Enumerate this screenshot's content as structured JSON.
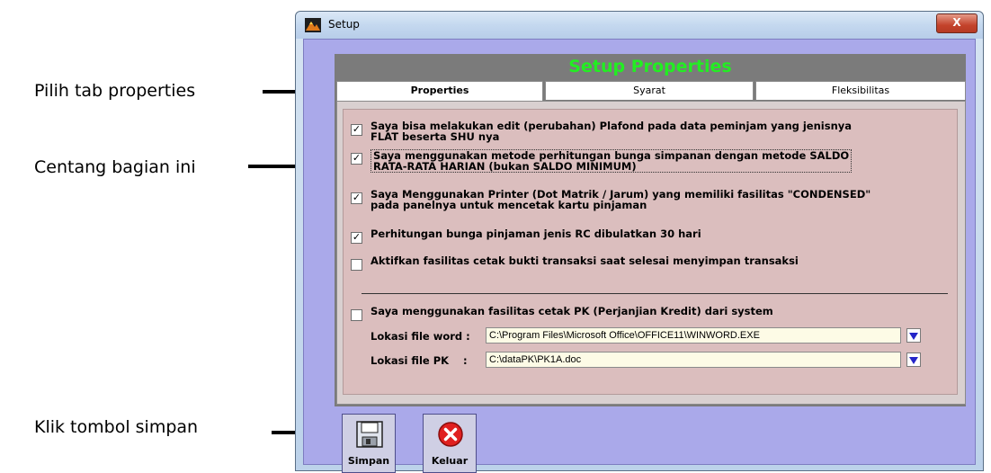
{
  "annotations": {
    "tab": "Pilih tab properties",
    "check": "Centang bagian ini",
    "save": "Klik tombol simpan"
  },
  "window": {
    "title": "Setup",
    "close_label": "X"
  },
  "heading": "Setup Properties",
  "tabs": [
    {
      "label": "Properties",
      "active": true
    },
    {
      "label": "Syarat",
      "active": false
    },
    {
      "label": "Fleksibilitas",
      "active": false
    }
  ],
  "options": [
    {
      "label": "Saya bisa melakukan edit (perubahan) Plafond pada data peminjam yang jenisnya\nFLAT beserta SHU nya",
      "checked": true
    },
    {
      "label": "Saya menggunakan metode perhitungan bunga simpanan dengan metode SALDO\nRATA-RATA HARIAN (bukan SALDO MINIMUM)",
      "checked": true
    },
    {
      "label": "Saya Menggunakan Printer (Dot Matrik / Jarum) yang memiliki fasilitas \"CONDENSED\"\npada panelnya untuk mencetak kartu pinjaman",
      "checked": true
    },
    {
      "label": "Perhitungan bunga pinjaman jenis RC dibulatkan 30 hari",
      "checked": true
    },
    {
      "label": "Aktifkan fasilitas cetak bukti transaksi saat selesai menyimpan transaksi",
      "checked": false
    }
  ],
  "pk_option": {
    "label": "Saya menggunakan  fasilitas cetak PK (Perjanjian Kredit) dari system",
    "checked": false
  },
  "word_file": {
    "label": "Lokasi file word :",
    "value": "C:\\Program Files\\Microsoft Office\\OFFICE11\\WINWORD.EXE"
  },
  "pk_file": {
    "label": "Lokasi file PK    :",
    "value": "C:\\dataPK\\PK1A.doc"
  },
  "buttons": {
    "save": "Simpan",
    "exit": "Keluar"
  },
  "colors": {
    "heading": "#22ee22",
    "client_bg": "#aaa9ea",
    "options_bg": "#dbbebe",
    "dropdown_arrow": "#2525c8",
    "exit_icon": "#e02020"
  }
}
